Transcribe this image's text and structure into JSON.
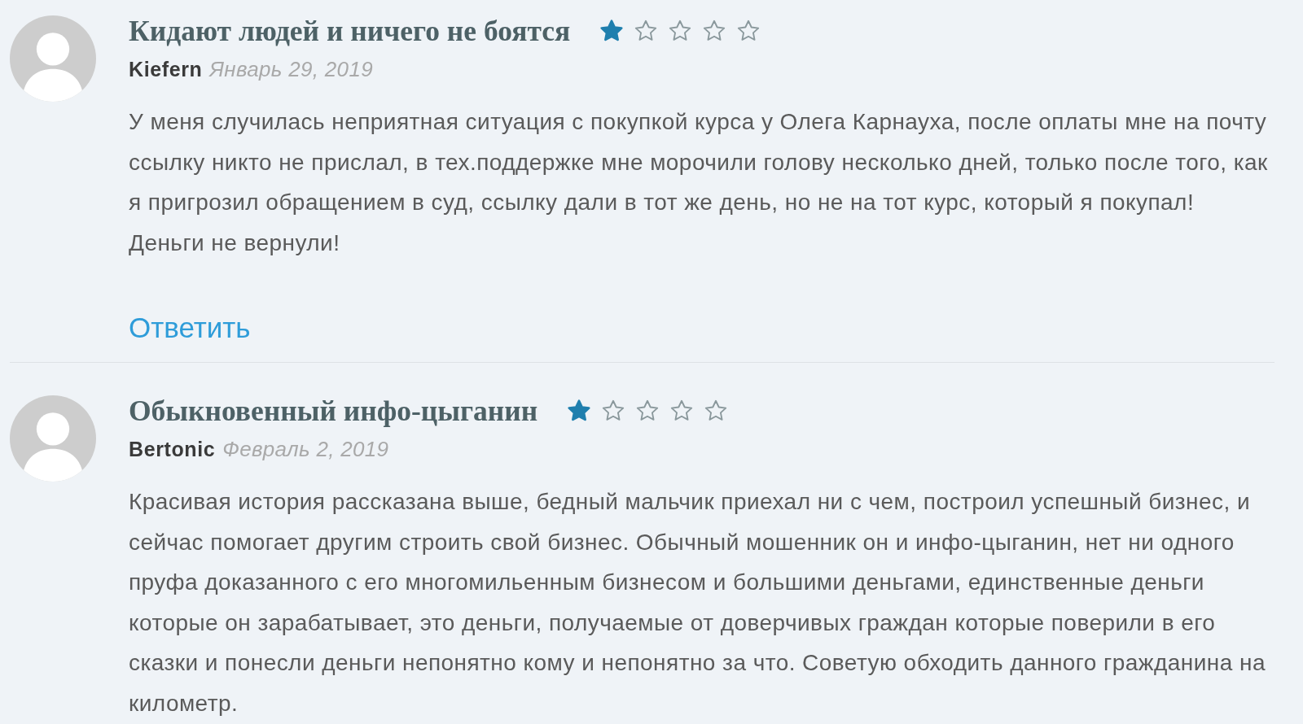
{
  "reviews": [
    {
      "title": "Кидают людей и ничего не боятся",
      "stars": 1,
      "author": "Kiefern",
      "date": "Январь 29, 2019",
      "text": "У меня случилась неприятная ситуация с покупкой курса у Олега Карнауха, после оплаты мне на почту ссылку никто не прислал, в тех.поддержке мне морочили голову несколько дней, только после того, как я пригрозил обращением в суд, ссылку дали в тот же день, но не на тот курс, который я покупал! Деньги не вернули!",
      "reply": "Ответить"
    },
    {
      "title": "Обыкновенный инфо-цыганин",
      "stars": 1,
      "author": "Bertonic",
      "date": "Февраль 2, 2019",
      "text": "Красивая история рассказана выше, бедный мальчик приехал ни с чем, построил успешный бизнес, и сейчас помогает другим строить свой бизнес. Обычный мошенник он и инфо-цыганин, нет ни одного пруфа доказанного с его многомильенным бизнесом и большими деньгами, единственные деньги которые он зарабатывает, это деньги, получаемые от доверчивых граждан которые поверили в его сказки и понесли деньги непонятно кому и непонятно за что. Советую обходить данного гражданина на километр."
    }
  ]
}
